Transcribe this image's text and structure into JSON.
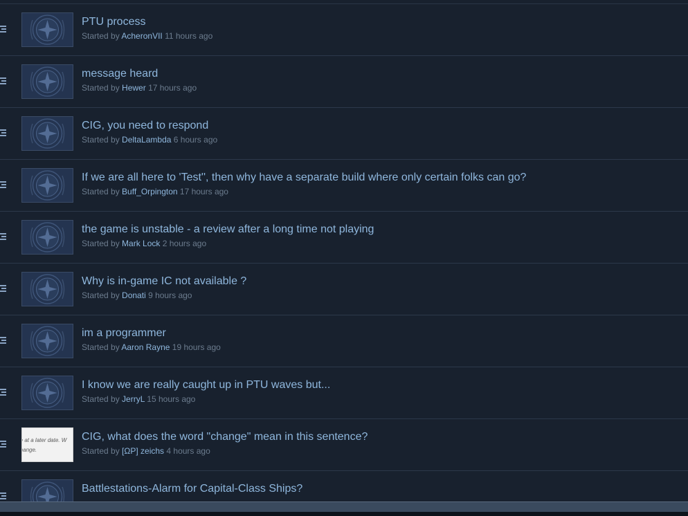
{
  "threads": [
    {
      "title": "PTU process",
      "started_by": "Started by",
      "author": "AcheronVII",
      "time": "11 hours ago",
      "avatar": "emblem"
    },
    {
      "title": "message heard",
      "started_by": "Started by",
      "author": "Hewer",
      "time": "17 hours ago",
      "avatar": "emblem"
    },
    {
      "title": "CIG, you need to respond",
      "started_by": "Started by",
      "author": "DeltaLambda",
      "time": "6 hours ago",
      "avatar": "emblem"
    },
    {
      "title": "If we are all here to 'Test'', then why have a separate build where only certain folks can go?",
      "started_by": "Started by",
      "author": "Buff_Orpington",
      "time": "17 hours ago",
      "avatar": "emblem"
    },
    {
      "title": "the game is unstable - a review after a long time not playing",
      "started_by": "Started by",
      "author": "Mark Lock",
      "time": "2 hours ago",
      "avatar": "emblem"
    },
    {
      "title": "Why is in-game IC not available ?",
      "started_by": "Started by",
      "author": "Donati",
      "time": "9 hours ago",
      "avatar": "emblem"
    },
    {
      "title": "im a programmer",
      "started_by": "Started by",
      "author": "Aaron Rayne",
      "time": "19 hours ago",
      "avatar": "emblem"
    },
    {
      "title": "I know we are really caught up in PTU waves but...",
      "started_by": "Started by",
      "author": "JerryL",
      "time": "15 hours ago",
      "avatar": "emblem"
    },
    {
      "title": "CIG, what does the word \"change\" mean in this sentence?",
      "started_by": "Started by",
      "author": "[ΩP] zeichs",
      "time": "4 hours ago",
      "avatar": "custom",
      "avatar_text": "able at a later date. W\no change."
    },
    {
      "title": "Battlestations-Alarm for Capital-Class Ships?",
      "started_by": "",
      "author": "",
      "time": "",
      "avatar": "emblem"
    }
  ],
  "colors": {
    "background": "#18212e",
    "link": "#8fb7dd",
    "muted": "#6c7c8e",
    "divider": "#2c394b"
  },
  "icons": {
    "row_handle": "drag-handle-icon",
    "avatar": "star-citizen-emblem-icon"
  }
}
